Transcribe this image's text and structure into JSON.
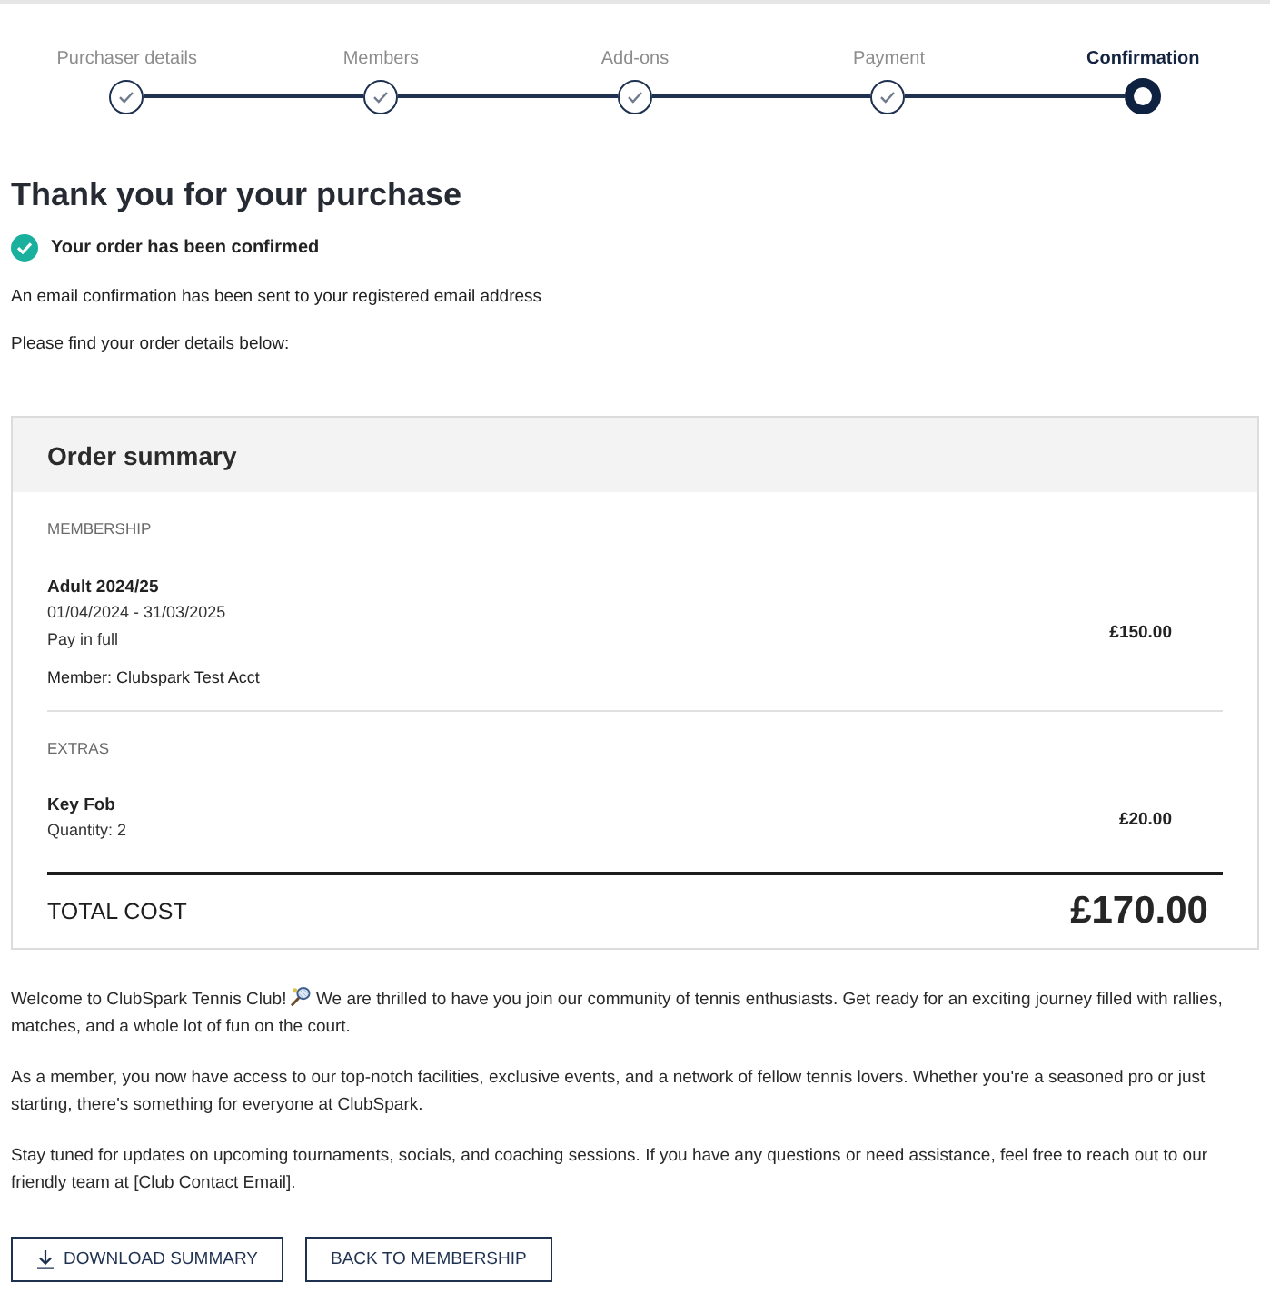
{
  "stepper": {
    "steps": [
      {
        "label": "Purchaser details",
        "completed": true,
        "selected": false
      },
      {
        "label": "Members",
        "completed": true,
        "selected": false
      },
      {
        "label": "Add-ons",
        "completed": true,
        "selected": false
      },
      {
        "label": "Payment",
        "completed": true,
        "selected": false
      },
      {
        "label": "Confirmation",
        "completed": false,
        "selected": true
      }
    ]
  },
  "heading": "Thank you for your purchase",
  "confirmation": {
    "text": "Your order has been confirmed"
  },
  "messages": [
    "An email confirmation has been sent to your registered email address",
    "Please find your order details below:"
  ],
  "order_summary": {
    "title": "Order summary",
    "sections": [
      {
        "heading": "MEMBERSHIP",
        "items": [
          {
            "name": "Adult 2024/25",
            "details": [
              "01/04/2024 - 31/03/2025",
              "Pay in full"
            ],
            "member": "Member: Clubspark Test Acct",
            "price": "£150.00"
          }
        ]
      },
      {
        "heading": "EXTRAS",
        "items": [
          {
            "name": "Key Fob",
            "details": [
              "Quantity: 2"
            ],
            "price": "£20.00"
          }
        ]
      }
    ],
    "total": {
      "label": "TOTAL COST",
      "amount": "£170.00"
    }
  },
  "welcome_paragraphs": [
    {
      "parts": [
        "Welcome to ClubSpark Tennis Club!",
        "We are thrilled to have you join our community of tennis enthusiasts. Get ready for an exciting journey filled with rallies, matches, and a whole lot of fun on the court."
      ]
    },
    {
      "parts": [
        "As a member, you now have access to our top-notch facilities, exclusive events, and a network of fellow tennis lovers. Whether you're a seasoned pro or just starting, there's something for everyone at ClubSpark."
      ]
    },
    {
      "parts": [
        "Stay tuned for updates on upcoming tournaments, socials, and coaching sessions. If you have any questions or need assistance, feel free to reach out to our friendly team at [Club Contact Email]."
      ]
    }
  ],
  "buttons": [
    {
      "label": "DOWNLOAD SUMMARY",
      "kind": "download"
    },
    {
      "label": "BACK TO MEMBERSHIP",
      "kind": "navigate"
    }
  ]
}
